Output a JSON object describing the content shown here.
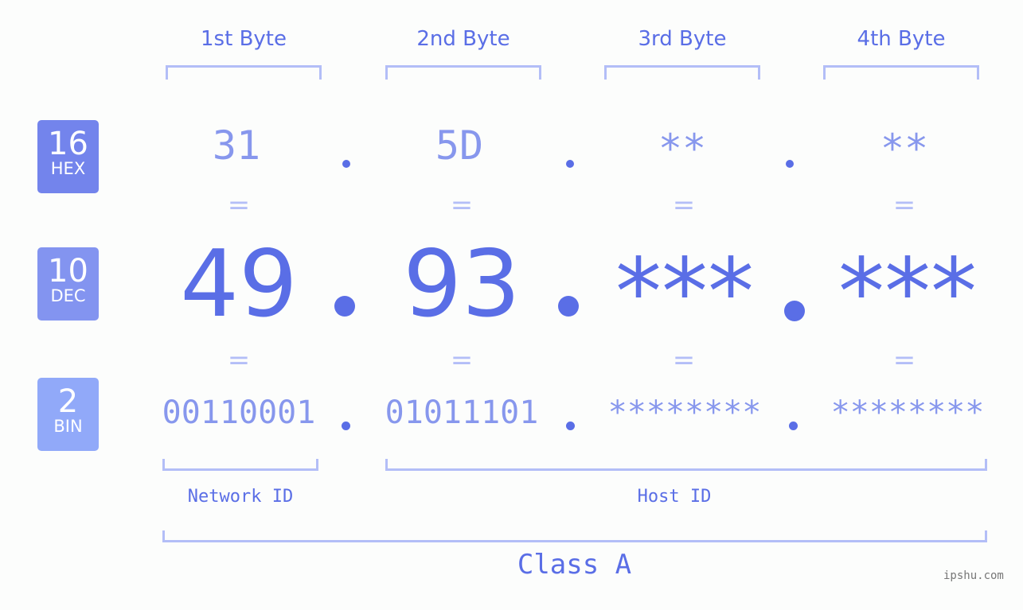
{
  "bases": [
    {
      "num": "16",
      "label": "HEX",
      "color": "#7384ec"
    },
    {
      "num": "10",
      "label": "DEC",
      "color": "#8394f0"
    },
    {
      "num": "2",
      "label": "BIN",
      "color": "#91a9f9"
    }
  ],
  "byte_headers": [
    "1st Byte",
    "2nd Byte",
    "3rd Byte",
    "4th Byte"
  ],
  "hex": [
    "31",
    "5D",
    "**",
    "**"
  ],
  "dec": [
    "49",
    "93",
    "***",
    "***"
  ],
  "bin": [
    "00110001",
    "01011101",
    "********",
    "********"
  ],
  "equals_sign": "=",
  "network_id_label": "Network ID",
  "host_id_label": "Host ID",
  "class_label": "Class A",
  "watermark": "ipshu.com",
  "colors": {
    "primary": "#5a6ee6",
    "light": "#8797ed",
    "bracket": "#b3bef7"
  }
}
